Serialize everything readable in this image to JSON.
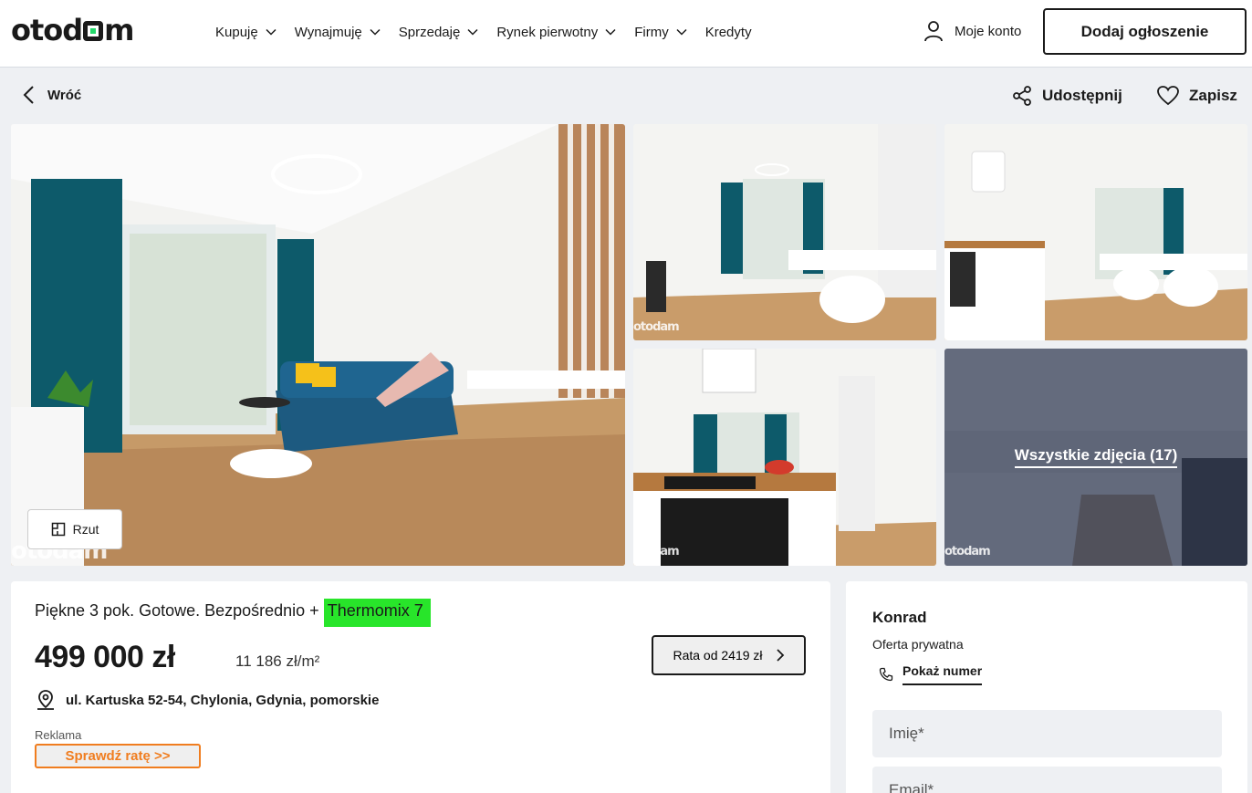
{
  "header": {
    "logo_text": "otodom",
    "nav": [
      {
        "label": "Kupuję",
        "has_dropdown": true
      },
      {
        "label": "Wynajmuję",
        "has_dropdown": true
      },
      {
        "label": "Sprzedaję",
        "has_dropdown": true
      },
      {
        "label": "Rynek pierwotny",
        "has_dropdown": true
      },
      {
        "label": "Firmy",
        "has_dropdown": true
      },
      {
        "label": "Kredyty",
        "has_dropdown": false
      }
    ],
    "account_label": "Moje konto",
    "add_listing_label": "Dodaj ogłoszenie"
  },
  "toolbar": {
    "back_label": "Wróć",
    "share_label": "Udostępnij",
    "save_label": "Zapisz"
  },
  "gallery": {
    "all_photos_label": "Wszystkie zdjęcia (17)",
    "floorplan_label": "Rzut",
    "watermark": "otodam"
  },
  "listing": {
    "title_prefix": "Piękne 3 pok. Gotowe. Bezpośrednio + ",
    "title_highlight": "Thermomix 7",
    "price": "499 000 zł",
    "price_per_m2": "11 186 zł/m²",
    "installment_label": "Rata od 2419 zł",
    "address": "ul. Kartuska 52-54, Chylonia, Gdynia, pomorskie",
    "ad_label": "Reklama",
    "ad_button_label": "Sprawdź ratę >>"
  },
  "contact": {
    "name": "Konrad",
    "offer_type": "Oferta prywatna",
    "show_number_label": "Pokaż numer",
    "name_placeholder": "Imię*",
    "email_placeholder": "Email*"
  },
  "colors": {
    "highlight": "#28e52a",
    "ad_accent": "#f07d1f",
    "background": "#eef0f3",
    "logo_accent": "#23d96a"
  }
}
